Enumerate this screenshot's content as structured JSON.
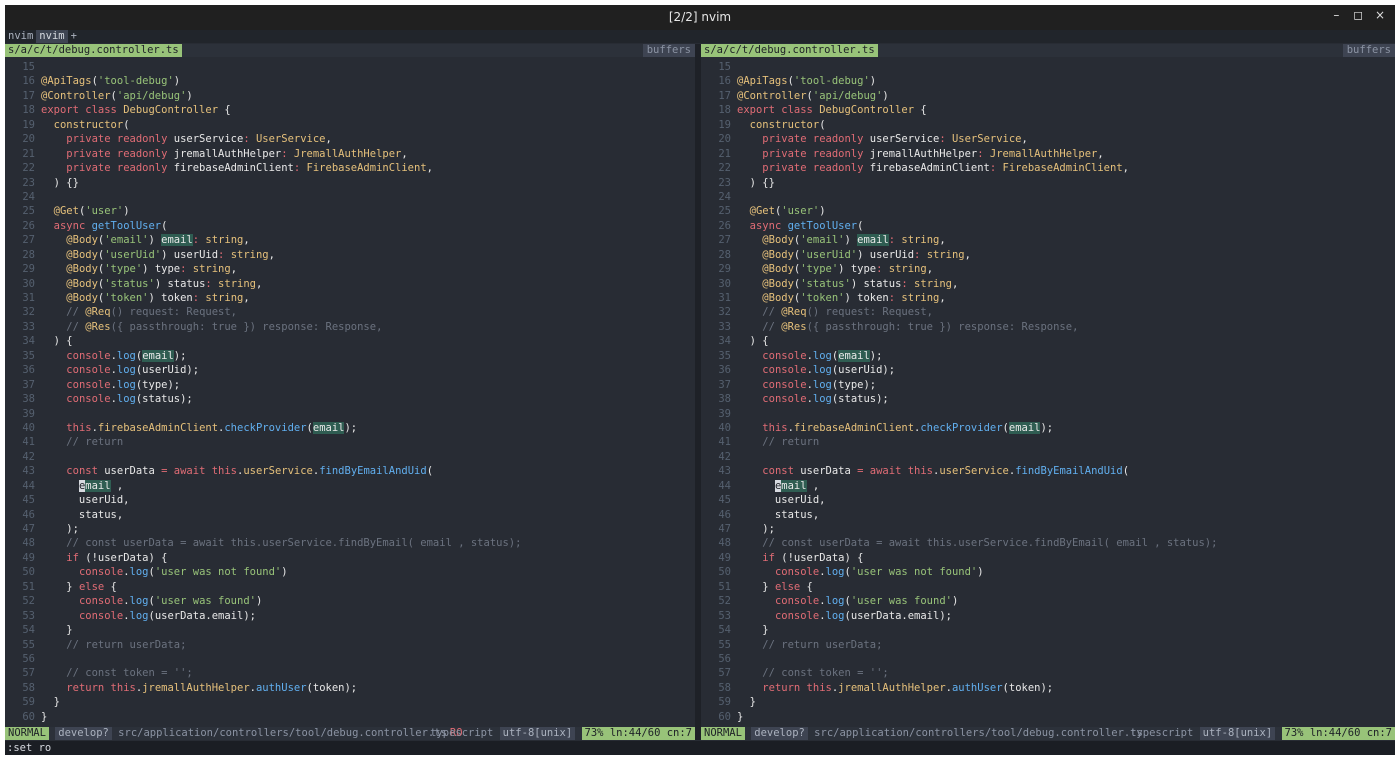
{
  "window": {
    "title": "[2/2] nvim",
    "controls": {
      "minimize": "–",
      "maximize": "◻",
      "close": "×"
    }
  },
  "tabline": {
    "tabs": [
      {
        "label": "nvim",
        "selected": false
      },
      {
        "label": "nvim",
        "selected": true
      }
    ],
    "new_tab": "+"
  },
  "panes": {
    "left": {
      "file_short": "s/a/c/t/debug.controller.ts",
      "buffers_label": "buffers"
    },
    "right": {
      "file_short": "s/a/c/t/debug.controller.ts",
      "buffers_label": "buffers"
    }
  },
  "code": {
    "lines": [
      {
        "n": "15",
        "t": []
      },
      {
        "n": "16",
        "t": [
          [
            "dec",
            "@ApiTags"
          ],
          [
            "tx",
            "("
          ],
          [
            "str",
            "'tool-debug'"
          ],
          [
            "tx",
            ")"
          ]
        ]
      },
      {
        "n": "17",
        "t": [
          [
            "dec",
            "@Controller"
          ],
          [
            "tx",
            "("
          ],
          [
            "str",
            "'api/debug'"
          ],
          [
            "tx",
            ")"
          ]
        ]
      },
      {
        "n": "18",
        "t": [
          [
            "kw",
            "export class "
          ],
          [
            "ty",
            "DebugController"
          ],
          [
            "tx",
            " {"
          ]
        ]
      },
      {
        "n": "19",
        "t": [
          [
            "tx",
            "  "
          ],
          [
            "dec",
            "constructor"
          ],
          [
            "tx",
            "("
          ]
        ]
      },
      {
        "n": "20",
        "t": [
          [
            "tx",
            "    "
          ],
          [
            "kw",
            "private readonly "
          ],
          [
            "tx",
            "userService"
          ],
          [
            "kw",
            ": "
          ],
          [
            "ty",
            "UserService"
          ],
          [
            "tx",
            ","
          ]
        ]
      },
      {
        "n": "21",
        "t": [
          [
            "tx",
            "    "
          ],
          [
            "kw",
            "private readonly "
          ],
          [
            "tx",
            "jremallAuthHelper"
          ],
          [
            "kw",
            ": "
          ],
          [
            "ty",
            "JremallAuthHelper"
          ],
          [
            "tx",
            ","
          ]
        ]
      },
      {
        "n": "22",
        "t": [
          [
            "tx",
            "    "
          ],
          [
            "kw",
            "private readonly "
          ],
          [
            "tx",
            "firebaseAdminClient"
          ],
          [
            "kw",
            ": "
          ],
          [
            "ty",
            "FirebaseAdminClient"
          ],
          [
            "tx",
            ","
          ]
        ]
      },
      {
        "n": "23",
        "t": [
          [
            "tx",
            "  ) {}"
          ]
        ]
      },
      {
        "n": "24",
        "t": []
      },
      {
        "n": "25",
        "t": [
          [
            "tx",
            "  "
          ],
          [
            "dec",
            "@Get"
          ],
          [
            "tx",
            "("
          ],
          [
            "str",
            "'user'"
          ],
          [
            "tx",
            ")"
          ]
        ]
      },
      {
        "n": "26",
        "t": [
          [
            "tx",
            "  "
          ],
          [
            "kw",
            "async "
          ],
          [
            "fn",
            "getToolUser"
          ],
          [
            "tx",
            "("
          ]
        ]
      },
      {
        "n": "27",
        "t": [
          [
            "tx",
            "    "
          ],
          [
            "dec",
            "@Body"
          ],
          [
            "tx",
            "("
          ],
          [
            "str",
            "'email'"
          ],
          [
            "tx",
            ") "
          ],
          [
            "hl",
            "email"
          ],
          [
            "kw",
            ": "
          ],
          [
            "ty",
            "string"
          ],
          [
            "tx",
            ","
          ]
        ]
      },
      {
        "n": "28",
        "t": [
          [
            "tx",
            "    "
          ],
          [
            "dec",
            "@Body"
          ],
          [
            "tx",
            "("
          ],
          [
            "str",
            "'userUid'"
          ],
          [
            "tx",
            ") userUid"
          ],
          [
            "kw",
            ": "
          ],
          [
            "ty",
            "string"
          ],
          [
            "tx",
            ","
          ]
        ]
      },
      {
        "n": "29",
        "t": [
          [
            "tx",
            "    "
          ],
          [
            "dec",
            "@Body"
          ],
          [
            "tx",
            "("
          ],
          [
            "str",
            "'type'"
          ],
          [
            "tx",
            ") type"
          ],
          [
            "kw",
            ": "
          ],
          [
            "ty",
            "string"
          ],
          [
            "tx",
            ","
          ]
        ]
      },
      {
        "n": "30",
        "t": [
          [
            "tx",
            "    "
          ],
          [
            "dec",
            "@Body"
          ],
          [
            "tx",
            "("
          ],
          [
            "str",
            "'status'"
          ],
          [
            "tx",
            ") status"
          ],
          [
            "kw",
            ": "
          ],
          [
            "ty",
            "string"
          ],
          [
            "tx",
            ","
          ]
        ]
      },
      {
        "n": "31",
        "t": [
          [
            "tx",
            "    "
          ],
          [
            "dec",
            "@Body"
          ],
          [
            "tx",
            "("
          ],
          [
            "str",
            "'token'"
          ],
          [
            "tx",
            ") token"
          ],
          [
            "kw",
            ": "
          ],
          [
            "ty",
            "string"
          ],
          [
            "tx",
            ","
          ]
        ]
      },
      {
        "n": "32",
        "t": [
          [
            "com",
            "    // "
          ],
          [
            "dec",
            "@Req"
          ],
          [
            "com",
            "() request: Request,"
          ]
        ]
      },
      {
        "n": "33",
        "t": [
          [
            "com",
            "    // "
          ],
          [
            "dec",
            "@Res"
          ],
          [
            "com",
            "({ passthrough: true }) response: Response,"
          ]
        ]
      },
      {
        "n": "34",
        "t": [
          [
            "tx",
            "  ) {"
          ]
        ]
      },
      {
        "n": "35",
        "t": [
          [
            "tx",
            "    "
          ],
          [
            "kw",
            "console"
          ],
          [
            "tx",
            "."
          ],
          [
            "fn",
            "log"
          ],
          [
            "tx",
            "("
          ],
          [
            "hl",
            "email"
          ],
          [
            "tx",
            ");"
          ]
        ]
      },
      {
        "n": "36",
        "t": [
          [
            "tx",
            "    "
          ],
          [
            "kw",
            "console"
          ],
          [
            "tx",
            "."
          ],
          [
            "fn",
            "log"
          ],
          [
            "tx",
            "(userUid);"
          ]
        ]
      },
      {
        "n": "37",
        "t": [
          [
            "tx",
            "    "
          ],
          [
            "kw",
            "console"
          ],
          [
            "tx",
            "."
          ],
          [
            "fn",
            "log"
          ],
          [
            "tx",
            "(type);"
          ]
        ]
      },
      {
        "n": "38",
        "t": [
          [
            "tx",
            "    "
          ],
          [
            "kw",
            "console"
          ],
          [
            "tx",
            "."
          ],
          [
            "fn",
            "log"
          ],
          [
            "tx",
            "(status);"
          ]
        ]
      },
      {
        "n": "39",
        "t": []
      },
      {
        "n": "40",
        "t": [
          [
            "tx",
            "    "
          ],
          [
            "kw",
            "this"
          ],
          [
            "tx",
            "."
          ],
          [
            "dec",
            "firebaseAdminClient"
          ],
          [
            "tx",
            "."
          ],
          [
            "fn",
            "checkProvider"
          ],
          [
            "tx",
            "("
          ],
          [
            "hl",
            "email"
          ],
          [
            "tx",
            ");"
          ]
        ]
      },
      {
        "n": "41",
        "t": [
          [
            "com",
            "    // return"
          ]
        ]
      },
      {
        "n": "42",
        "t": []
      },
      {
        "n": "43",
        "t": [
          [
            "tx",
            "    "
          ],
          [
            "kw",
            "const "
          ],
          [
            "tx",
            "userData "
          ],
          [
            "kw",
            "= await "
          ],
          [
            "kw",
            "this"
          ],
          [
            "tx",
            "."
          ],
          [
            "dec",
            "userService"
          ],
          [
            "tx",
            "."
          ],
          [
            "fn",
            "findByEmailAndUid"
          ],
          [
            "tx",
            "("
          ]
        ]
      },
      {
        "n": "44",
        "t": [
          [
            "tx",
            "      "
          ],
          [
            "cur",
            "e"
          ],
          [
            "hl",
            "mail"
          ],
          [
            "tx",
            " ,"
          ]
        ]
      },
      {
        "n": "45",
        "t": [
          [
            "tx",
            "      userUid,"
          ]
        ]
      },
      {
        "n": "46",
        "t": [
          [
            "tx",
            "      status,"
          ]
        ]
      },
      {
        "n": "47",
        "t": [
          [
            "tx",
            "    );"
          ]
        ]
      },
      {
        "n": "48",
        "t": [
          [
            "com",
            "    // const userData = await this.userService.findByEmail( email , status);"
          ]
        ]
      },
      {
        "n": "49",
        "t": [
          [
            "tx",
            "    "
          ],
          [
            "kw",
            "if "
          ],
          [
            "tx",
            "(!userData) {"
          ]
        ]
      },
      {
        "n": "50",
        "t": [
          [
            "tx",
            "      "
          ],
          [
            "kw",
            "console"
          ],
          [
            "tx",
            "."
          ],
          [
            "fn",
            "log"
          ],
          [
            "tx",
            "("
          ],
          [
            "str",
            "'user was not found'"
          ],
          [
            "tx",
            ")"
          ]
        ]
      },
      {
        "n": "51",
        "t": [
          [
            "tx",
            "    } "
          ],
          [
            "kw",
            "else "
          ],
          [
            "tx",
            "{"
          ]
        ]
      },
      {
        "n": "52",
        "t": [
          [
            "tx",
            "      "
          ],
          [
            "kw",
            "console"
          ],
          [
            "tx",
            "."
          ],
          [
            "fn",
            "log"
          ],
          [
            "tx",
            "("
          ],
          [
            "str",
            "'user was found'"
          ],
          [
            "tx",
            ")"
          ]
        ]
      },
      {
        "n": "53",
        "t": [
          [
            "tx",
            "      "
          ],
          [
            "kw",
            "console"
          ],
          [
            "tx",
            "."
          ],
          [
            "fn",
            "log"
          ],
          [
            "tx",
            "(userData.email);"
          ]
        ]
      },
      {
        "n": "54",
        "t": [
          [
            "tx",
            "    }"
          ]
        ]
      },
      {
        "n": "55",
        "t": [
          [
            "com",
            "    // return userData;"
          ]
        ]
      },
      {
        "n": "56",
        "t": []
      },
      {
        "n": "57",
        "t": [
          [
            "com",
            "    // const token = '';"
          ]
        ]
      },
      {
        "n": "58",
        "t": [
          [
            "tx",
            "    "
          ],
          [
            "kw",
            "return this"
          ],
          [
            "tx",
            "."
          ],
          [
            "dec",
            "jremallAuthHelper"
          ],
          [
            "tx",
            "."
          ],
          [
            "fn",
            "authUser"
          ],
          [
            "tx",
            "(token);"
          ]
        ]
      },
      {
        "n": "59",
        "t": [
          [
            "tx",
            "  }"
          ]
        ]
      },
      {
        "n": "60",
        "t": [
          [
            "tx",
            "}"
          ]
        ]
      }
    ]
  },
  "status": {
    "left": {
      "mode": "NORMAL",
      "branch": "develop?",
      "path": "src/application/controllers/tool/debug.controller.ts",
      "readonly": "RO",
      "filetype": "typescript",
      "encoding": "utf-8[unix]",
      "position": "73% ln:44/60 cn:7"
    },
    "right": {
      "mode": "NORMAL",
      "branch": "develop?",
      "path": "src/application/controllers/tool/debug.controller.ts",
      "filetype": "typescript",
      "encoding": "utf-8[unix]",
      "position": "73% ln:44/60 cn:7"
    }
  },
  "cmdline": ":set ro",
  "colors": {
    "background": "#282c34",
    "keyword": "#e06c75",
    "decorator": "#e5c07b",
    "string": "#98c379",
    "function": "#61afef",
    "comment": "#6b727f",
    "highlight": "#2f5d52"
  }
}
